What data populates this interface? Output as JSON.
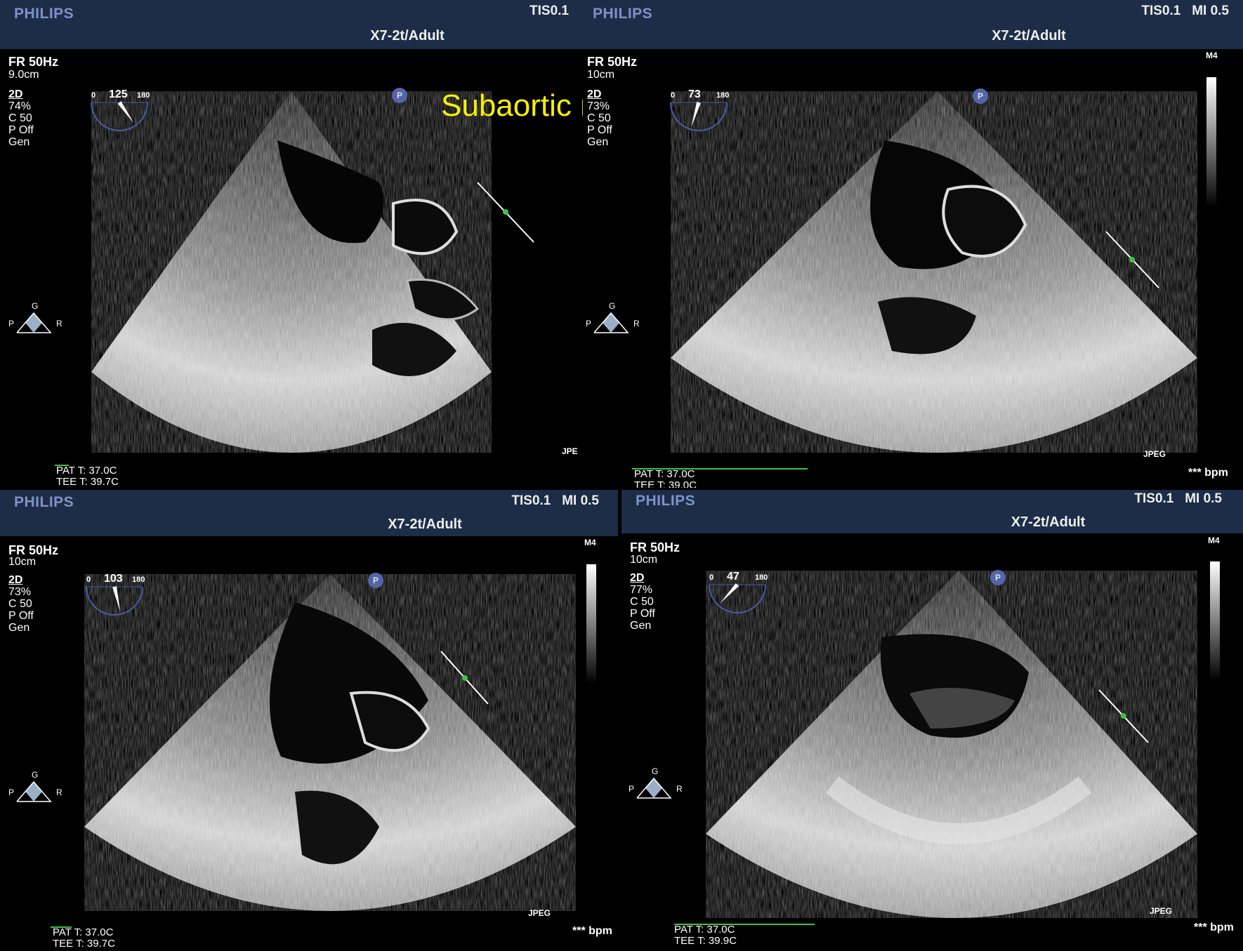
{
  "overlay_label": "Subaortic membrane",
  "colors": {
    "header_bg": "#1d2d47",
    "brand": "#7d93c7",
    "overlay": "#f5f000",
    "ecg_line": "#3ec33e"
  },
  "panels": [
    {
      "brand": "PHILIPS",
      "tis": "TIS0.1",
      "probe": "X7-2t/Adult",
      "fr": "FR 50Hz",
      "depth": "9.0cm",
      "mode": "2D",
      "gain": "74%",
      "comp": "C 50",
      "persist": "P Off",
      "res": "Gen",
      "angle_min": "0",
      "angle_max": "180",
      "angle": "125",
      "angle_degrees": 125,
      "orient_g": "G",
      "orient_p": "P",
      "orient_r": "R",
      "pat_t": "PAT T: 37.0C",
      "tee_t": "TEE T: 39.7C",
      "jpeg": "JPE",
      "bpm": "",
      "m4": ""
    },
    {
      "brand": "PHILIPS",
      "tis": "TIS0.1   MI 0.5",
      "probe": "X7-2t/Adult",
      "fr": "FR 50Hz",
      "depth": "10cm",
      "mode": "2D",
      "gain": "73%",
      "comp": "C 50",
      "persist": "P Off",
      "res": "Gen",
      "angle_min": "0",
      "angle_max": "180",
      "angle": "73",
      "angle_degrees": 73,
      "orient_g": "G",
      "orient_p": "P",
      "orient_r": "R",
      "pat_t": "PAT T: 37.0C",
      "tee_t": "TEE T: 39.0C",
      "jpeg": "JPEG",
      "bpm": "*** bpm",
      "m4": "M4"
    },
    {
      "brand": "PHILIPS",
      "tis": "TIS0.1   MI 0.5",
      "probe": "X7-2t/Adult",
      "fr": "FR 50Hz",
      "depth": "10cm",
      "mode": "2D",
      "gain": "73%",
      "comp": "C 50",
      "persist": "P Off",
      "res": "Gen",
      "angle_min": "0",
      "angle_max": "180",
      "angle": "103",
      "angle_degrees": 103,
      "orient_g": "G",
      "orient_p": "P",
      "orient_r": "R",
      "pat_t": "PAT T: 37.0C",
      "tee_t": "TEE T: 39.7C",
      "jpeg": "JPEG",
      "bpm": "*** bpm",
      "m4": "M4"
    },
    {
      "brand": "PHILIPS",
      "tis": "TIS0.1   MI 0.5",
      "probe": "X7-2t/Adult",
      "fr": "FR 50Hz",
      "depth": "10cm",
      "mode": "2D",
      "gain": "77%",
      "comp": "C 50",
      "persist": "P Off",
      "res": "Gen",
      "angle_min": "0",
      "angle_max": "180",
      "angle": "47",
      "angle_degrees": 47,
      "orient_g": "G",
      "orient_p": "P",
      "orient_r": "R",
      "pat_t": "PAT T: 37.0C",
      "tee_t": "TEE T: 39.9C",
      "jpeg": "JPEG",
      "bpm": "*** bpm",
      "m4": "M4"
    }
  ]
}
